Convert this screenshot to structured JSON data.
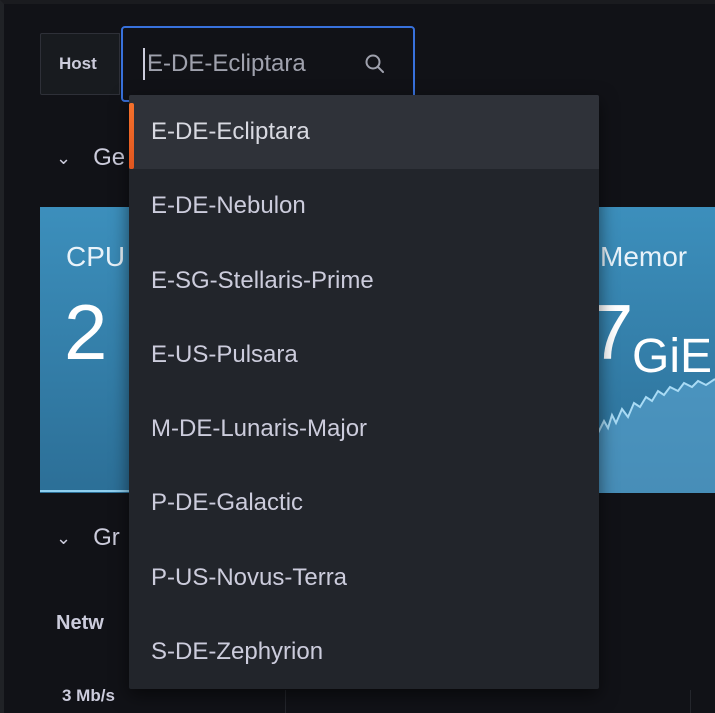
{
  "variable": {
    "label": "Host",
    "value": "E-DE-Ecliptara",
    "search_icon": "search-icon"
  },
  "sections": {
    "general_partial": "Ge",
    "graphs_partial": "Gr",
    "chevron_icon": "chevron-down-icon"
  },
  "panels": {
    "cpu": {
      "title_partial": "CPU",
      "value_partial": "2"
    },
    "memory": {
      "title_partial": "Memor",
      "value_partial": "7",
      "unit_partial": "GiE"
    },
    "network": {
      "title_partial": "Netw",
      "axis_tick": "3 Mb/s"
    },
    "stat_color": "#3c8fbc"
  },
  "dropdown": {
    "selected_index": 0,
    "accent_color": "#f5712c",
    "options": [
      {
        "label": "E-DE-Ecliptara"
      },
      {
        "label": "E-DE-Nebulon"
      },
      {
        "label": "E-SG-Stellaris-Prime"
      },
      {
        "label": "E-US-Pulsara"
      },
      {
        "label": "M-DE-Lunaris-Major"
      },
      {
        "label": "P-DE-Galactic"
      },
      {
        "label": "P-US-Novus-Terra"
      },
      {
        "label": "S-DE-Zephyrion"
      }
    ]
  }
}
